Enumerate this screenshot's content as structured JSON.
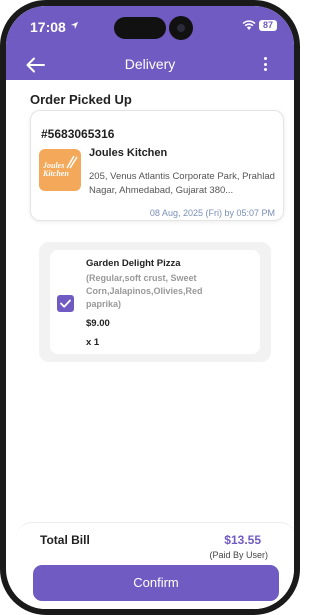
{
  "status_bar": {
    "time": "17:08",
    "battery": "87"
  },
  "app_bar": {
    "title": "Delivery"
  },
  "section": {
    "title": "Order Picked Up"
  },
  "order": {
    "id": "#5683065316",
    "restaurant_name": "Joules Kitchen",
    "logo_text_line1": "Joules",
    "logo_text_line2": "Kitchen",
    "address": "205, Venus Atlantis Corporate Park, Prahlad Nagar, Ahmedabad, Gujarat 380...",
    "date": "08 Aug, 2025 (Fri) by 05:07 PM"
  },
  "item": {
    "name": "Garden Delight Pizza",
    "description": "(Regular,soft crust, Sweet Corn,Jalapinos,Olivies,Red paprika)",
    "price": "$9.00",
    "quantity": "x 1",
    "checked": true
  },
  "bill": {
    "label": "Total Bill",
    "amount": "$13.55",
    "paid_by": "(Paid By User)"
  },
  "actions": {
    "confirm_label": "Confirm"
  },
  "colors": {
    "accent": "#6f5bc2",
    "logo_bg": "#f4a85a",
    "date_text": "#7a8fb8"
  }
}
